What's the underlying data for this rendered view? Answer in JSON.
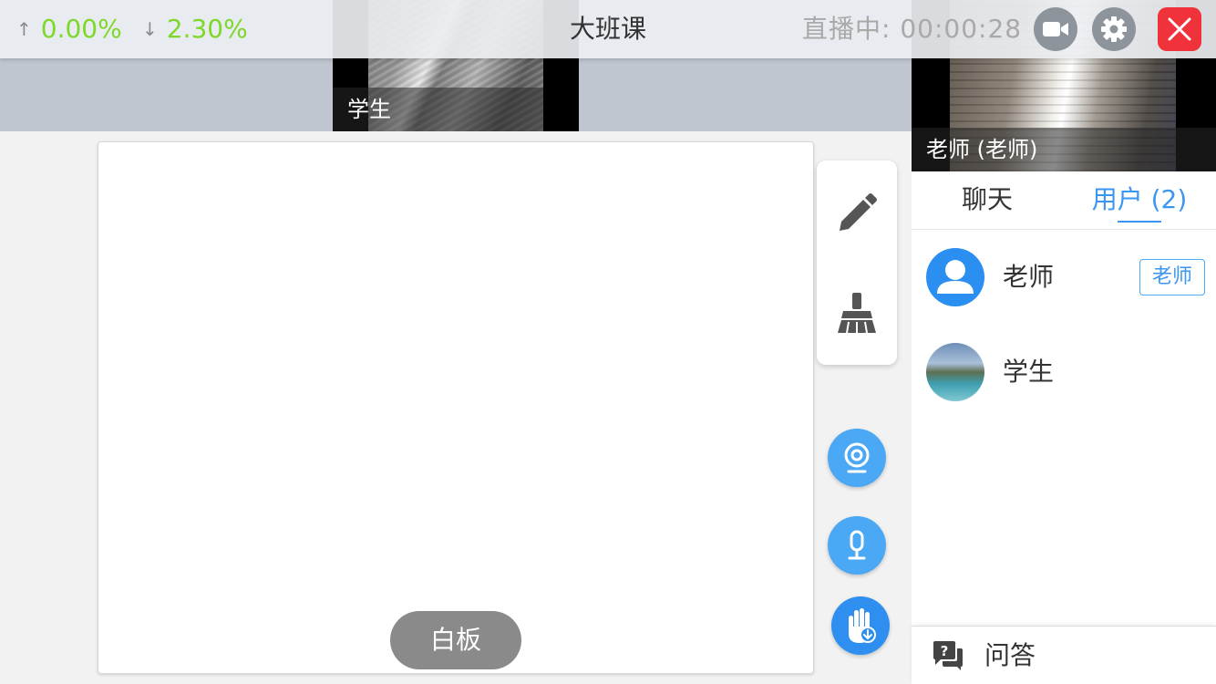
{
  "header": {
    "upload_rate": "0.00%",
    "download_rate": "2.30%",
    "title": "大班课",
    "live_status": "直播中:  00:00:28"
  },
  "videos": {
    "student_label": "学生",
    "teacher_label": "老师 (老师)"
  },
  "whiteboard": {
    "label": "白板"
  },
  "side_panel": {
    "tabs": [
      {
        "label": "聊天"
      },
      {
        "label": "用户 (2)"
      }
    ],
    "users": [
      {
        "name": "老师",
        "role": "老师"
      },
      {
        "name": "学生"
      }
    ],
    "qa_label": "问答"
  },
  "colors": {
    "accent": "#3a96f0",
    "network": "#7dd82a",
    "close": "#f0323a"
  }
}
